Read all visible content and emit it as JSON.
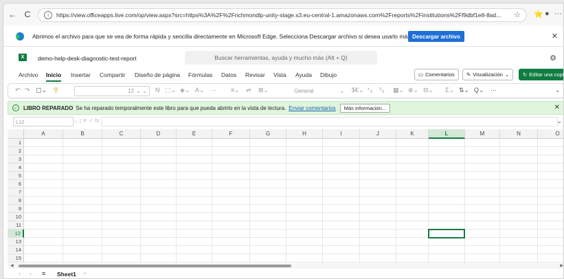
{
  "browser": {
    "url": "https://view.officeapps.live.com/op/view.aspx?src=https%3A%2F%2Frichmondlp-unity-stage.s3.eu-central-1.amazonaws.com%2Freports%2Finstitutions%2Ff9dbf1e8-8ad...",
    "back_icon": "←",
    "refresh_icon": "C",
    "favorites_icon": "☆",
    "collections_icon": "⭐",
    "profile_icon": "●",
    "more_icon": "···"
  },
  "edge_notice": {
    "message": "Abrimos el archivo para que se vea de forma rápida y sencilla directamente en Microsoft Edge. Selecciona Descargar archivo si desea usarlo más adelante.",
    "download_label": "Descargar archivo",
    "close_icon": "✕"
  },
  "excel": {
    "app_icon_text": "X",
    "document_title": "demo-help-desk-diagnostic-test-report",
    "search_placeholder": "Buscar herramientas, ayuda y mucho más (Alt + Q)",
    "settings_icon": "⚙",
    "tabs": [
      "Archivo",
      "Inicio",
      "Insertar",
      "Compartir",
      "Diseño de página",
      "Fórmulas",
      "Datos",
      "Revisar",
      "Vista",
      "Ayuda",
      "Dibujo"
    ],
    "active_tab": "Inicio",
    "comments_label": "Comentarios",
    "view_label": "Visualización",
    "edit_copy_label": "Editar una copia",
    "toolbar": {
      "undo": "↶",
      "redo": "↷",
      "font_size": "12",
      "bold": "N",
      "number_format": "General",
      "more": "···",
      "sum": "Σ",
      "find": "Q",
      "dots": "···",
      "expand": "⌄"
    },
    "repair": {
      "title": "LIBRO REPARADO",
      "message": "Se ha reparado temporalmente este libro para que pueda abrirlo en la vista de lectura.",
      "link": "Enviar comentarios",
      "more_info": "Más información...",
      "close_icon": "✕"
    },
    "name_box": "L12",
    "fx_tools": "⌄ | ✕ ✓ fx |",
    "columns": [
      "A",
      "B",
      "C",
      "D",
      "E",
      "F",
      "G",
      "H",
      "I",
      "J",
      "K",
      "L",
      "M",
      "N",
      "O"
    ],
    "rows": [
      "1",
      "2",
      "3",
      "4",
      "5",
      "6",
      "7",
      "8",
      "9",
      "10",
      "11",
      "12",
      "13",
      "14",
      "15"
    ],
    "selected_column": "L",
    "selected_row": "12",
    "sheet_name": "Sheet1",
    "sheet_nav_prev": "‹",
    "sheet_nav_next": "›",
    "sheet_menu_icon": "≡",
    "add_sheet_icon": "+"
  }
}
